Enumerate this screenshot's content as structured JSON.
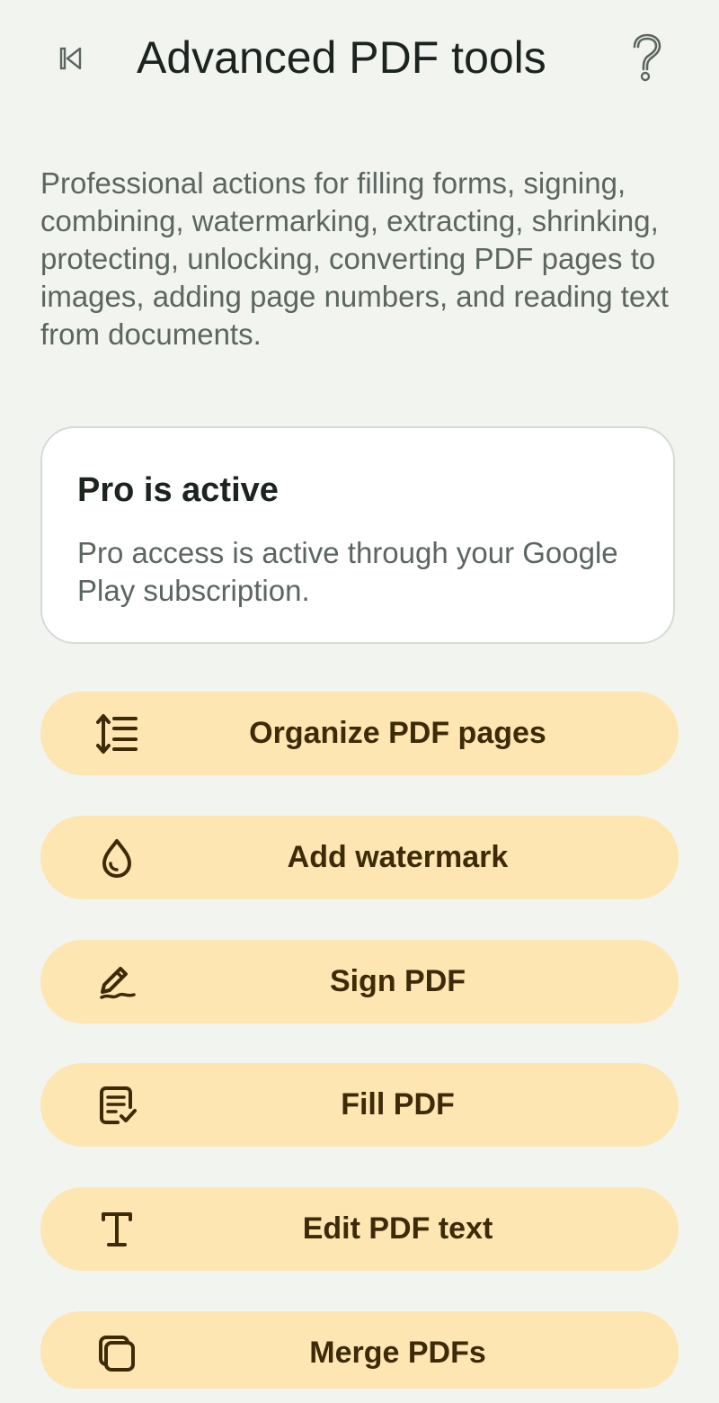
{
  "header": {
    "title": "Advanced PDF tools",
    "back_icon": "back-to-start-icon",
    "help_icon": "help-question-icon"
  },
  "description": "Professional actions for filling forms, signing, combining, watermarking, extracting, shrinking, protecting, unlocking, converting PDF pages to images, adding page numbers, and reading text from documents.",
  "pro_card": {
    "title": "Pro is active",
    "text": "Pro access is active through your Google Play subscription."
  },
  "tools": [
    {
      "label": "Organize PDF pages",
      "icon": "reorder-list-icon"
    },
    {
      "label": "Add watermark",
      "icon": "water-drop-icon"
    },
    {
      "label": "Sign PDF",
      "icon": "signature-pen-icon"
    },
    {
      "label": "Fill PDF",
      "icon": "form-check-icon"
    },
    {
      "label": "Edit PDF text",
      "icon": "text-cursor-icon"
    },
    {
      "label": "Merge PDFs",
      "icon": "stacked-pages-icon"
    }
  ],
  "colors": {
    "background": "#f2f4f0",
    "button_fill": "#fde6b2",
    "button_text": "#3d2a08",
    "card_fill": "#ffffff",
    "muted_text": "#5c6660"
  }
}
